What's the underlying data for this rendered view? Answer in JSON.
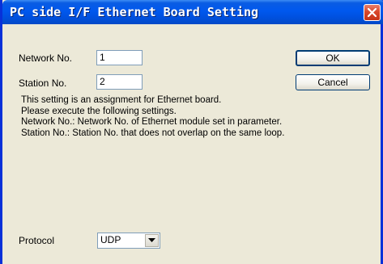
{
  "window": {
    "title": "PC side I/F Ethernet Board Setting",
    "close_icon": "close-icon"
  },
  "form": {
    "network_label": "Network No.",
    "network_value": "1",
    "station_label": "Station No.",
    "station_value": "2",
    "protocol_label": "Protocol",
    "protocol_value": "UDP"
  },
  "buttons": {
    "ok": "OK",
    "cancel": "Cancel"
  },
  "description": [
    "This setting is an assignment for Ethernet board.",
    "Please execute the following settings.",
    "Network No.: Network No. of Ethernet module set in parameter.",
    "Station No.: Station No. that does not overlap on the same loop."
  ],
  "colors": {
    "titlebar": "#0058ee",
    "dialog_bg": "#ece9d8",
    "close_button": "#d9482c"
  }
}
